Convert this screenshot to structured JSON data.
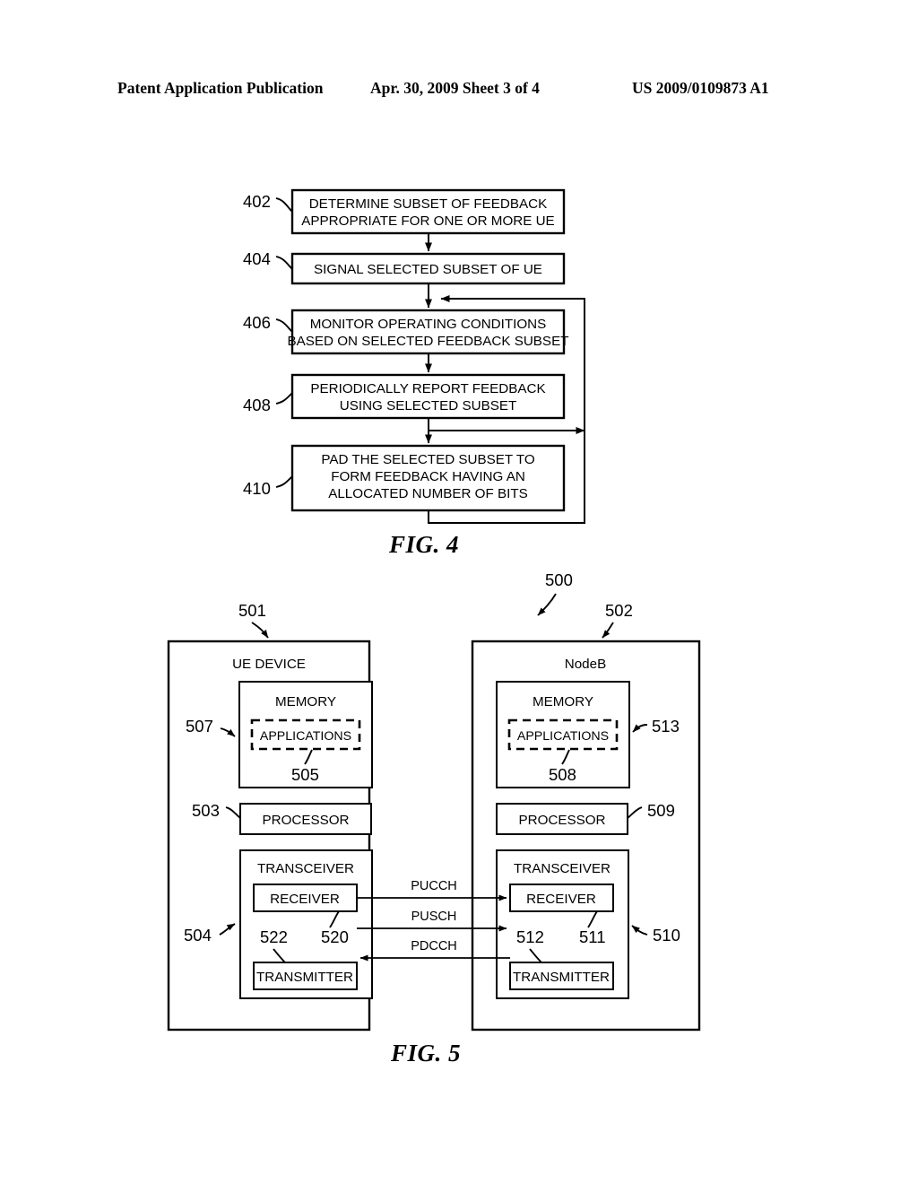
{
  "header": {
    "publication": "Patent Application Publication",
    "date_sheet": "Apr. 30, 2009  Sheet 3 of 4",
    "patent_number": "US 2009/0109873 A1"
  },
  "figures": [
    {
      "caption": "FIG. 4",
      "type": "flowchart",
      "steps": [
        {
          "ref": "402",
          "lines": [
            "DETERMINE SUBSET OF FEEDBACK",
            "APPROPRIATE FOR ONE OR MORE UE"
          ]
        },
        {
          "ref": "404",
          "lines": [
            "SIGNAL SELECTED SUBSET OF UE"
          ]
        },
        {
          "ref": "406",
          "lines": [
            "MONITOR OPERATING CONDITIONS",
            "BASED ON SELECTED FEEDBACK SUBSET"
          ]
        },
        {
          "ref": "408",
          "lines": [
            "PERIODICALLY REPORT FEEDBACK",
            "USING SELECTED SUBSET"
          ]
        },
        {
          "ref": "410",
          "lines": [
            "PAD THE SELECTED SUBSET TO",
            "FORM FEEDBACK HAVING AN",
            "ALLOCATED NUMBER OF BITS"
          ]
        }
      ]
    },
    {
      "caption": "FIG. 5",
      "type": "block-diagram",
      "system_ref": "500",
      "nodes": [
        {
          "ref": "501",
          "title": "UE DEVICE",
          "memory": {
            "label": "MEMORY",
            "applications_label": "APPLICATIONS",
            "applications_ref": "505",
            "memory_ref": "507"
          },
          "processor": {
            "label": "PROCESSOR",
            "ref": "503"
          },
          "transceiver": {
            "label": "TRANSCEIVER",
            "ref": "504",
            "receiver_label": "RECEIVER",
            "receiver_ref": "520",
            "transmitter_label": "TRANSMITTER",
            "transmitter_ref": "522"
          }
        },
        {
          "ref": "502",
          "title": "NodeB",
          "memory": {
            "label": "MEMORY",
            "applications_label": "APPLICATIONS",
            "applications_ref": "508",
            "memory_ref": "513"
          },
          "processor": {
            "label": "PROCESSOR",
            "ref": "509"
          },
          "transceiver": {
            "label": "TRANSCEIVER",
            "ref": "510",
            "receiver_label": "RECEIVER",
            "receiver_ref": "511",
            "transmitter_label": "TRANSMITTER",
            "transmitter_ref": "512"
          }
        }
      ],
      "channels": [
        {
          "name": "PUCCH",
          "direction": "ue-to-nodeb"
        },
        {
          "name": "PUSCH",
          "direction": "ue-to-nodeb"
        },
        {
          "name": "PDCCH",
          "direction": "nodeb-to-ue"
        }
      ]
    }
  ]
}
